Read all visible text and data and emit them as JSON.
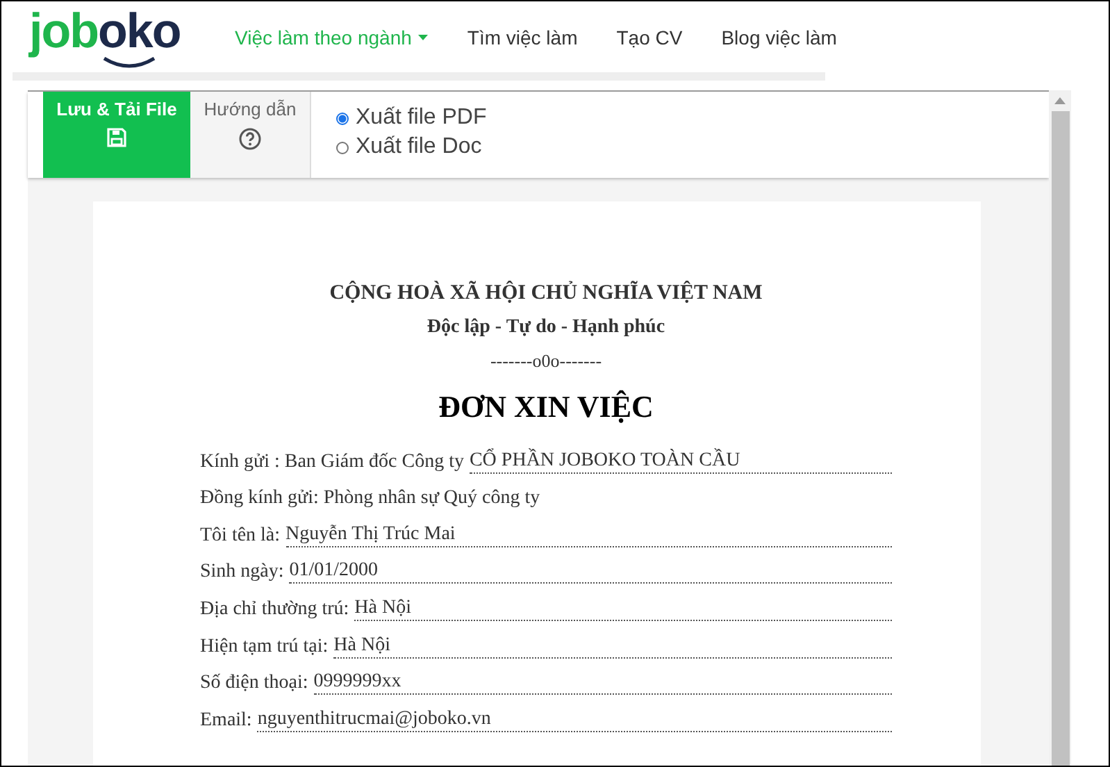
{
  "logo": {
    "part_1": "job",
    "part_2": "oko"
  },
  "nav": [
    {
      "label": "Việc làm theo ngành",
      "selected": true,
      "dropdown": true
    },
    {
      "label": "Tìm việc làm",
      "selected": false,
      "dropdown": false
    },
    {
      "label": "Tạo CV",
      "selected": false,
      "dropdown": false
    },
    {
      "label": "Blog việc làm",
      "selected": false,
      "dropdown": false
    }
  ],
  "toolbar": {
    "save_button": "Lưu & Tải File",
    "guide_button": "Hướng dẫn",
    "export_options": [
      {
        "label": "Xuất file PDF",
        "selected": true
      },
      {
        "label": "Xuất file Doc",
        "selected": false
      }
    ]
  },
  "document": {
    "header": "CỘNG HOÀ XÃ HỘI CHỦ NGHĨA VIỆT NAM",
    "motto": "Độc lập - Tự do - Hạnh phúc",
    "separator": "-------o0o-------",
    "title": "ĐƠN XIN VIỆC",
    "fields": [
      {
        "kind": "field",
        "label": "Kính gửi : Ban Giám đốc Công ty",
        "value": "CỔ PHẦN JOBOKO TOÀN CẦU"
      },
      {
        "kind": "text",
        "label": "Đồng kính gửi: Phòng nhân sự Quý công ty"
      },
      {
        "kind": "field",
        "label": "Tôi tên là:",
        "value": "Nguyễn Thị Trúc Mai"
      },
      {
        "kind": "field",
        "label": "Sinh ngày:",
        "value": "01/01/2000"
      },
      {
        "kind": "field",
        "label": "Địa chỉ thường trú:",
        "value": "Hà Nội"
      },
      {
        "kind": "field",
        "label": "Hiện tạm trú tại:",
        "value": "Hà Nội"
      },
      {
        "kind": "field",
        "label": "Số điện thoại:",
        "value": "0999999xx"
      },
      {
        "kind": "field",
        "label": "Email:",
        "value": "nguyenthitrucmai@joboko.vn"
      }
    ]
  }
}
